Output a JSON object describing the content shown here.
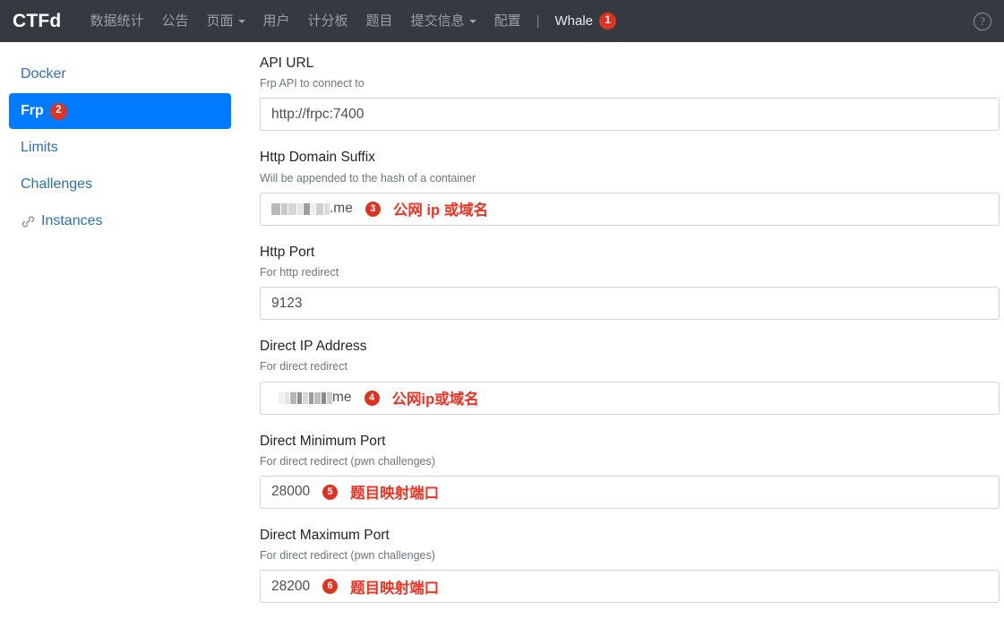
{
  "navbar": {
    "brand": "CTFd",
    "items": [
      {
        "label": "数据统计",
        "caret": false
      },
      {
        "label": "公告",
        "caret": false
      },
      {
        "label": "页面",
        "caret": true
      },
      {
        "label": "用户",
        "caret": false
      },
      {
        "label": "计分板",
        "caret": false
      },
      {
        "label": "题目",
        "caret": false
      },
      {
        "label": "提交信息",
        "caret": true
      },
      {
        "label": "配置",
        "caret": false
      },
      {
        "label": "|",
        "caret": false,
        "separator": true
      },
      {
        "label": "Whale",
        "caret": false,
        "bright": true,
        "badge": "1"
      }
    ],
    "help_icon": "question-circle-icon",
    "background_color": "#343a40",
    "text_color": "#9ba0a6"
  },
  "sidebar": {
    "items": [
      {
        "label": "Docker",
        "active": false,
        "icon": null,
        "badge": null
      },
      {
        "label": "Frp",
        "active": true,
        "icon": null,
        "badge": "2"
      },
      {
        "label": "Limits",
        "active": false,
        "icon": null,
        "badge": null
      },
      {
        "label": "Challenges",
        "active": false,
        "icon": null,
        "badge": null
      },
      {
        "label": "Instances",
        "active": false,
        "icon": "link-icon",
        "badge": null
      }
    ],
    "active_color": "#007bff",
    "link_color": "#2c6fb8"
  },
  "form": {
    "fields": [
      {
        "label": "API URL",
        "help": "Frp API to connect to",
        "value": "http://frpc:7400",
        "redacted": false,
        "badge": null,
        "annotation": null
      },
      {
        "label": "Http Domain Suffix",
        "help": "Will be appended to the hash of a container",
        "value": ".me",
        "redacted": true,
        "badge": "3",
        "annotation": "公网 ip 或域名"
      },
      {
        "label": "Http Port",
        "help": "For http redirect",
        "value": "9123",
        "redacted": false,
        "badge": null,
        "annotation": null
      },
      {
        "label": "Direct IP Address",
        "help": "For direct redirect",
        "value": "me",
        "redacted": true,
        "badge": "4",
        "annotation": "公网ip或域名"
      },
      {
        "label": "Direct Minimum Port",
        "help": "For direct redirect (pwn challenges)",
        "value": "28000",
        "redacted": false,
        "badge": "5",
        "annotation": "题目映射端口"
      },
      {
        "label": "Direct Maximum Port",
        "help": "For direct redirect (pwn challenges)",
        "value": "28200",
        "redacted": false,
        "badge": "6",
        "annotation": "题目映射端口"
      }
    ],
    "annotation_color": "#ee3322",
    "badge_color": "#dc3322"
  }
}
